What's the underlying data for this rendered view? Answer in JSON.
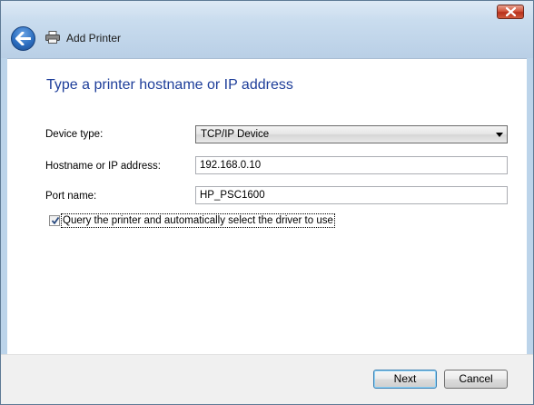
{
  "window": {
    "title": "Add Printer"
  },
  "page": {
    "heading": "Type a printer hostname or IP address"
  },
  "form": {
    "device_type_label": "Device type:",
    "device_type_value": "TCP/IP Device",
    "hostname_label": "Hostname or IP address:",
    "hostname_value": "192.168.0.10",
    "port_label": "Port name:",
    "port_value": "HP_PSC1600",
    "query_label": "Query the printer and automatically select the driver to use",
    "query_checked": true
  },
  "buttons": {
    "next": "Next",
    "cancel": "Cancel"
  },
  "icons": {
    "back": "back-arrow-icon",
    "printer": "printer-icon",
    "close": "close-icon"
  }
}
